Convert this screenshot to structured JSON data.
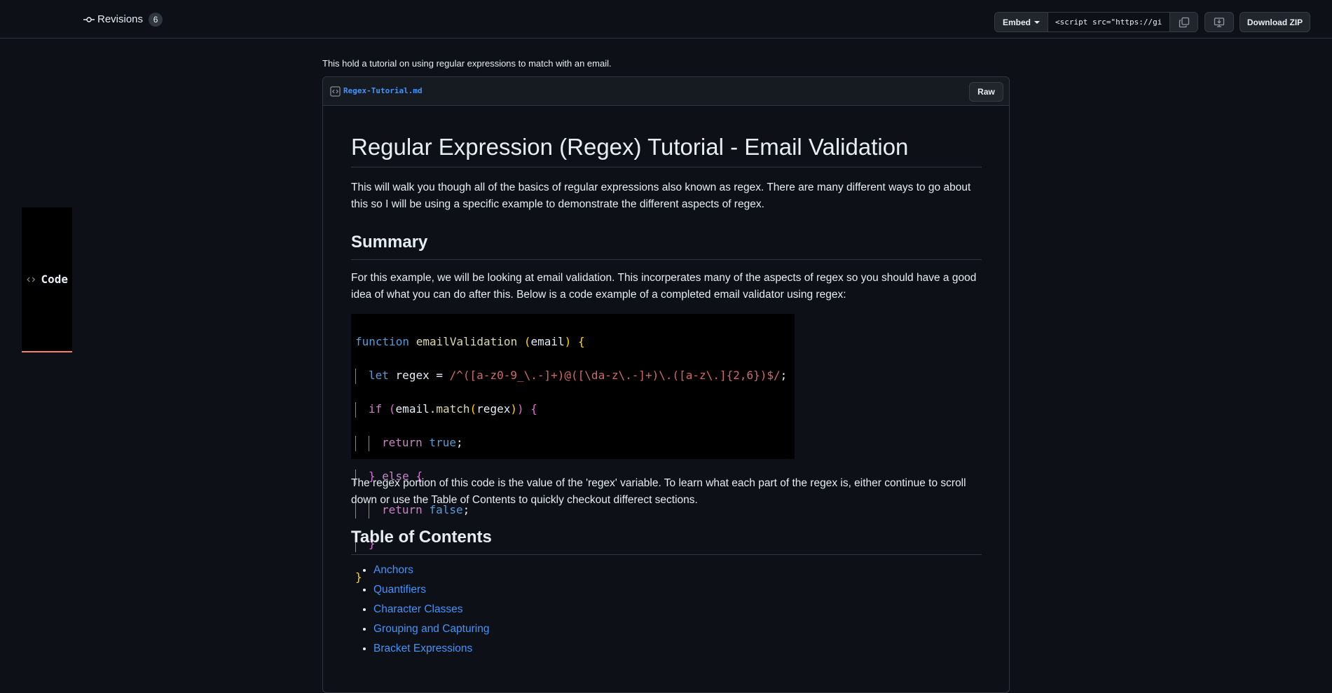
{
  "tabs": {
    "code_label": "Code",
    "revisions_label": "Revisions",
    "revisions_count": "6"
  },
  "actions": {
    "embed_label": "Embed",
    "embed_value": "<script src=\"https://gist",
    "download_label": "Download ZIP"
  },
  "gist": {
    "description": "This hold a tutorial on using regular expressions to match with an email.",
    "filename": "Regex-Tutorial.md",
    "raw_label": "Raw"
  },
  "doc": {
    "title": "Regular Expression (Regex) Tutorial - Email Validation",
    "intro": "This will walk you though all of the basics of regular expressions also known as regex. There are many different ways to go about this so I will be using a specific example to demonstrate the different aspects of regex.",
    "summary_heading": "Summary",
    "summary_text": "For this example, we will be looking at email validation. This incorperates many of the aspects of regex so you should have a good idea of what you can do after this. Below is a code example of a completed email validator using regex:",
    "after_code_text": "The regex portion of this code is the value of the 'regex' variable. To learn what each part of the regex is, either continue to scroll down or use the Table of Contents to quickly checkout differect sections.",
    "toc_heading": "Table of Contents",
    "toc_items": [
      "Anchors",
      "Quantifiers",
      "Character Classes",
      "Grouping and Capturing",
      "Bracket Expressions"
    ]
  },
  "code_lines": {
    "l1_kw": "function",
    "l1_fn": "emailValidation",
    "l1_arg": "email",
    "l2_kw": "let",
    "l2_var": "regex",
    "l2_op": "=",
    "l3_kw": "if",
    "l3_obj": "email",
    "l3_fn": "match",
    "l3_arg": "regex",
    "l4_kw": "return",
    "l4_val": "true",
    "l5_kw": "else",
    "l6_kw": "return",
    "l6_val": "false"
  }
}
